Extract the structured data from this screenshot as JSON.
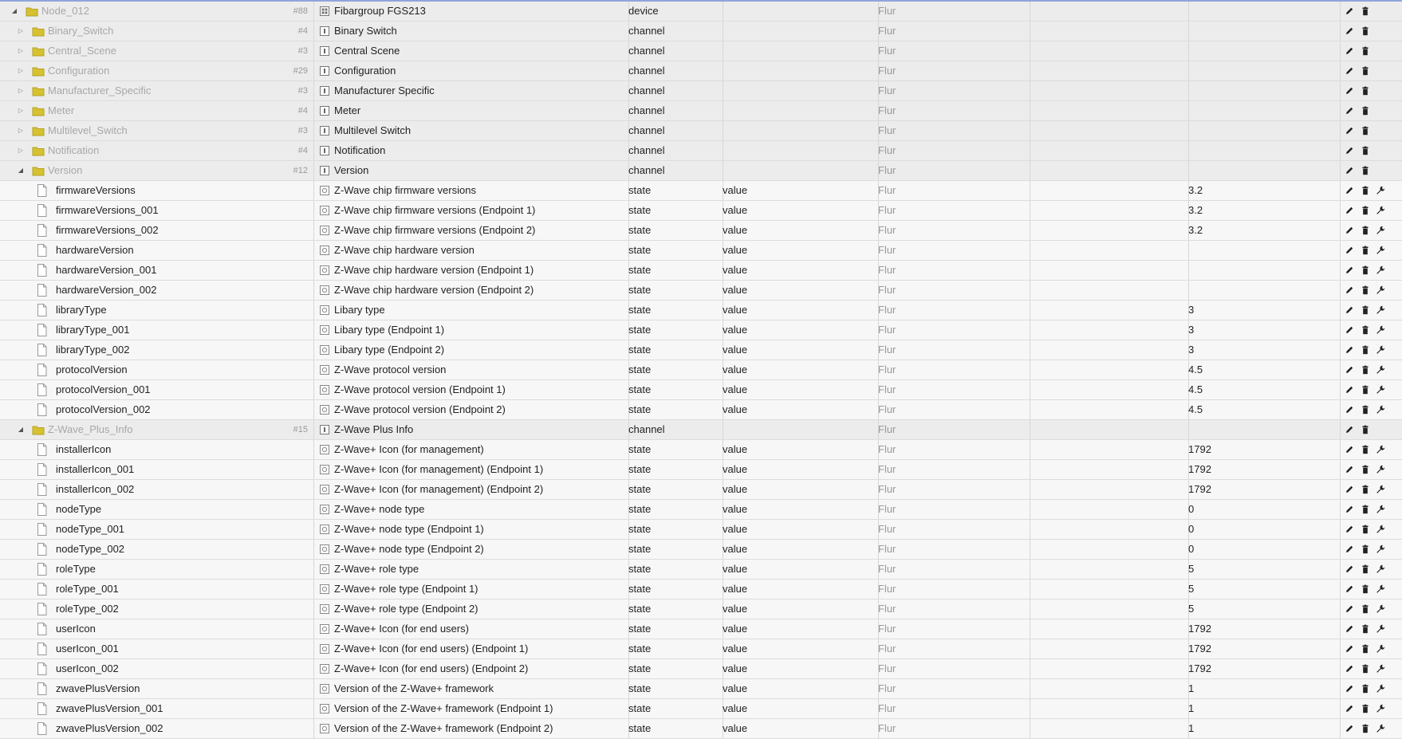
{
  "colors": {
    "folder": "#d6c230",
    "folder_dark": "#b5a11f",
    "room_text": "#9a9a9a",
    "object_id_text": "#a8a8a8"
  },
  "rows": [
    {
      "kind": "device",
      "level": 0,
      "expanded": true,
      "id": "Node_012",
      "count": "#88",
      "name": "Fibargroup FGS213",
      "type": "device",
      "role": "",
      "room": "Flur",
      "value": ""
    },
    {
      "kind": "channel",
      "level": 1,
      "expanded": false,
      "id": "Binary_Switch",
      "count": "#4",
      "name": "Binary Switch",
      "type": "channel",
      "role": "",
      "room": "Flur",
      "value": ""
    },
    {
      "kind": "channel",
      "level": 1,
      "expanded": false,
      "id": "Central_Scene",
      "count": "#3",
      "name": "Central Scene",
      "type": "channel",
      "role": "",
      "room": "Flur",
      "value": ""
    },
    {
      "kind": "channel",
      "level": 1,
      "expanded": false,
      "id": "Configuration",
      "count": "#29",
      "name": "Configuration",
      "type": "channel",
      "role": "",
      "room": "Flur",
      "value": ""
    },
    {
      "kind": "channel",
      "level": 1,
      "expanded": false,
      "id": "Manufacturer_Specific",
      "count": "#3",
      "name": "Manufacturer Specific",
      "type": "channel",
      "role": "",
      "room": "Flur",
      "value": ""
    },
    {
      "kind": "channel",
      "level": 1,
      "expanded": false,
      "id": "Meter",
      "count": "#4",
      "name": "Meter",
      "type": "channel",
      "role": "",
      "room": "Flur",
      "value": ""
    },
    {
      "kind": "channel",
      "level": 1,
      "expanded": false,
      "id": "Multilevel_Switch",
      "count": "#3",
      "name": "Multilevel Switch",
      "type": "channel",
      "role": "",
      "room": "Flur",
      "value": ""
    },
    {
      "kind": "channel",
      "level": 1,
      "expanded": false,
      "id": "Notification",
      "count": "#4",
      "name": "Notification",
      "type": "channel",
      "role": "",
      "room": "Flur",
      "value": ""
    },
    {
      "kind": "channel",
      "level": 1,
      "expanded": true,
      "id": "Version",
      "count": "#12",
      "name": "Version",
      "type": "channel",
      "role": "",
      "room": "Flur",
      "value": ""
    },
    {
      "kind": "state",
      "id": "firmwareVersions",
      "name": "Z-Wave chip firmware versions",
      "type": "state",
      "role": "value",
      "room": "Flur",
      "value": "3.2"
    },
    {
      "kind": "state",
      "id": "firmwareVersions_001",
      "name": "Z-Wave chip firmware versions (Endpoint 1)",
      "type": "state",
      "role": "value",
      "room": "Flur",
      "value": "3.2"
    },
    {
      "kind": "state",
      "id": "firmwareVersions_002",
      "name": "Z-Wave chip firmware versions (Endpoint 2)",
      "type": "state",
      "role": "value",
      "room": "Flur",
      "value": "3.2"
    },
    {
      "kind": "state",
      "id": "hardwareVersion",
      "name": "Z-Wave chip hardware version",
      "type": "state",
      "role": "value",
      "room": "Flur",
      "value": ""
    },
    {
      "kind": "state",
      "id": "hardwareVersion_001",
      "name": "Z-Wave chip hardware version (Endpoint 1)",
      "type": "state",
      "role": "value",
      "room": "Flur",
      "value": ""
    },
    {
      "kind": "state",
      "id": "hardwareVersion_002",
      "name": "Z-Wave chip hardware version (Endpoint 2)",
      "type": "state",
      "role": "value",
      "room": "Flur",
      "value": ""
    },
    {
      "kind": "state",
      "id": "libraryType",
      "name": "Libary type",
      "type": "state",
      "role": "value",
      "room": "Flur",
      "value": "3"
    },
    {
      "kind": "state",
      "id": "libraryType_001",
      "name": "Libary type (Endpoint 1)",
      "type": "state",
      "role": "value",
      "room": "Flur",
      "value": "3"
    },
    {
      "kind": "state",
      "id": "libraryType_002",
      "name": "Libary type (Endpoint 2)",
      "type": "state",
      "role": "value",
      "room": "Flur",
      "value": "3"
    },
    {
      "kind": "state",
      "id": "protocolVersion",
      "name": "Z-Wave protocol version",
      "type": "state",
      "role": "value",
      "room": "Flur",
      "value": "4.5"
    },
    {
      "kind": "state",
      "id": "protocolVersion_001",
      "name": "Z-Wave protocol version (Endpoint 1)",
      "type": "state",
      "role": "value",
      "room": "Flur",
      "value": "4.5"
    },
    {
      "kind": "state",
      "id": "protocolVersion_002",
      "name": "Z-Wave protocol version (Endpoint 2)",
      "type": "state",
      "role": "value",
      "room": "Flur",
      "value": "4.5"
    },
    {
      "kind": "channel",
      "level": 1,
      "expanded": true,
      "id": "Z-Wave_Plus_Info",
      "count": "#15",
      "name": "Z-Wave Plus Info",
      "type": "channel",
      "role": "",
      "room": "Flur",
      "value": ""
    },
    {
      "kind": "state",
      "id": "installerIcon",
      "name": "Z-Wave+ Icon (for management)",
      "type": "state",
      "role": "value",
      "room": "Flur",
      "value": "1792"
    },
    {
      "kind": "state",
      "id": "installerIcon_001",
      "name": "Z-Wave+ Icon (for management) (Endpoint 1)",
      "type": "state",
      "role": "value",
      "room": "Flur",
      "value": "1792"
    },
    {
      "kind": "state",
      "id": "installerIcon_002",
      "name": "Z-Wave+ Icon (for management) (Endpoint 2)",
      "type": "state",
      "role": "value",
      "room": "Flur",
      "value": "1792"
    },
    {
      "kind": "state",
      "id": "nodeType",
      "name": "Z-Wave+ node type",
      "type": "state",
      "role": "value",
      "room": "Flur",
      "value": "0"
    },
    {
      "kind": "state",
      "id": "nodeType_001",
      "name": "Z-Wave+ node type (Endpoint 1)",
      "type": "state",
      "role": "value",
      "room": "Flur",
      "value": "0"
    },
    {
      "kind": "state",
      "id": "nodeType_002",
      "name": "Z-Wave+ node type (Endpoint 2)",
      "type": "state",
      "role": "value",
      "room": "Flur",
      "value": "0"
    },
    {
      "kind": "state",
      "id": "roleType",
      "name": "Z-Wave+ role type",
      "type": "state",
      "role": "value",
      "room": "Flur",
      "value": "5"
    },
    {
      "kind": "state",
      "id": "roleType_001",
      "name": "Z-Wave+ role type (Endpoint 1)",
      "type": "state",
      "role": "value",
      "room": "Flur",
      "value": "5"
    },
    {
      "kind": "state",
      "id": "roleType_002",
      "name": "Z-Wave+ role type (Endpoint 2)",
      "type": "state",
      "role": "value",
      "room": "Flur",
      "value": "5"
    },
    {
      "kind": "state",
      "id": "userIcon",
      "name": "Z-Wave+ Icon (for end users)",
      "type": "state",
      "role": "value",
      "room": "Flur",
      "value": "1792"
    },
    {
      "kind": "state",
      "id": "userIcon_001",
      "name": "Z-Wave+ Icon (for end users) (Endpoint 1)",
      "type": "state",
      "role": "value",
      "room": "Flur",
      "value": "1792"
    },
    {
      "kind": "state",
      "id": "userIcon_002",
      "name": "Z-Wave+ Icon (for end users) (Endpoint 2)",
      "type": "state",
      "role": "value",
      "room": "Flur",
      "value": "1792"
    },
    {
      "kind": "state",
      "id": "zwavePlusVersion",
      "name": "Version of the Z-Wave+ framework",
      "type": "state",
      "role": "value",
      "room": "Flur",
      "value": "1"
    },
    {
      "kind": "state",
      "id": "zwavePlusVersion_001",
      "name": "Version of the Z-Wave+ framework (Endpoint 1)",
      "type": "state",
      "role": "value",
      "room": "Flur",
      "value": "1"
    },
    {
      "kind": "state",
      "id": "zwavePlusVersion_002",
      "name": "Version of the Z-Wave+ framework (Endpoint 2)",
      "type": "state",
      "role": "value",
      "room": "Flur",
      "value": "1"
    }
  ]
}
